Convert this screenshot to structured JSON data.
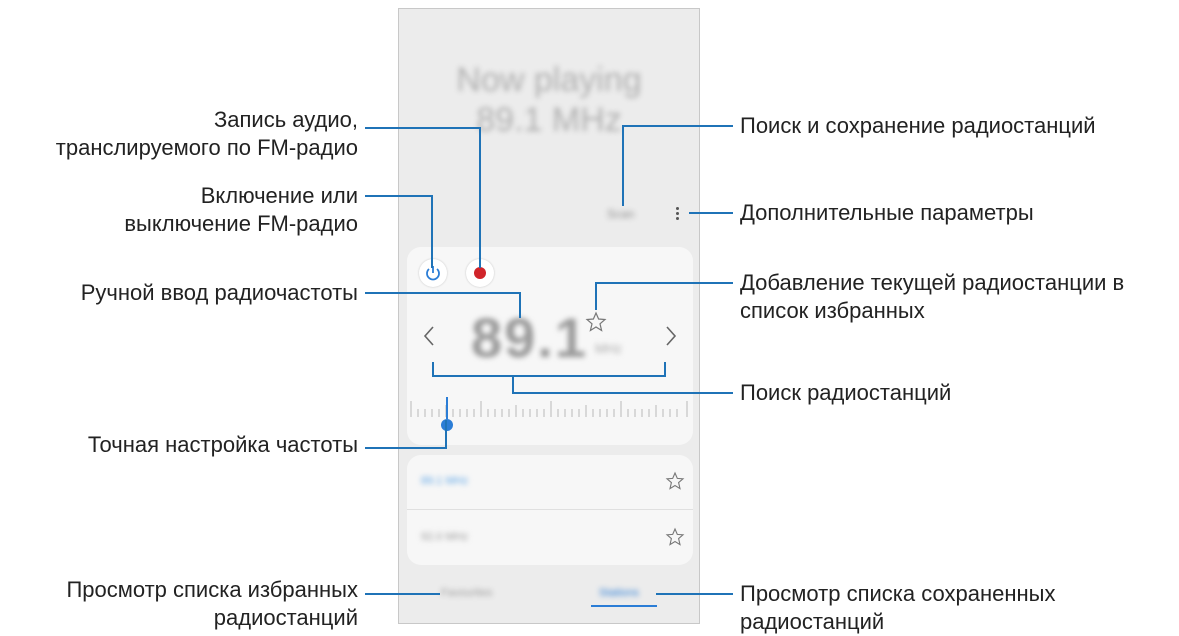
{
  "callouts": {
    "record": [
      "Запись аудио,",
      "транслируемого по FM-радио"
    ],
    "power": [
      "Включение или",
      "выключение FM-радио"
    ],
    "manual": [
      "Ручной ввод радиочастоты"
    ],
    "fine_tune": [
      "Точная настройка частоты"
    ],
    "favorites_view": [
      "Просмотр списка избранных",
      "радиостанций"
    ],
    "scan": [
      "Поиск и сохранение радиостанций"
    ],
    "more": [
      "Дополнительные параметры"
    ],
    "add_fav": [
      "Добавление текущей радиостанции в",
      "список избранных"
    ],
    "search": [
      "Поиск радиостанций"
    ],
    "saved_view": [
      "Просмотр списка сохраненных",
      "радиостанций"
    ]
  },
  "phone": {
    "now_playing": "Now playing",
    "now_freq": "89.1 MHz",
    "scan_label": "Scan",
    "frequency": "89.1",
    "unit": "MHz",
    "stations": [
      {
        "label": "89.1 MHz"
      },
      {
        "label": "92.0 MHz"
      }
    ],
    "tabs": {
      "favorites": "Favourites",
      "stations": "Stations"
    }
  },
  "colors": {
    "accent": "#2b7dd6",
    "record": "#d0242a",
    "line": "#1f73b7"
  }
}
